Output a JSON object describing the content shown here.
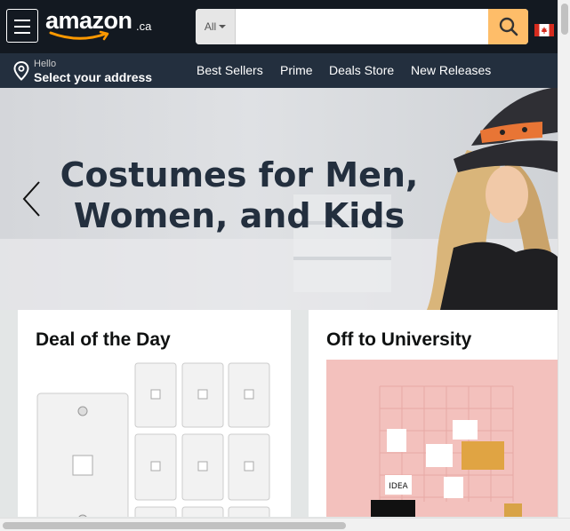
{
  "header": {
    "logo_text": "amazon",
    "logo_suffix": ".ca",
    "search": {
      "category": "All",
      "placeholder": "",
      "value": ""
    },
    "icons": {
      "menu": "hamburger-menu-icon",
      "search": "search-icon",
      "flag": "canada-flag-icon"
    },
    "colors": {
      "header_bg": "#131921",
      "nav_bg": "#232f3e",
      "search_button": "#febd69",
      "logo_smile": "#ff9900"
    }
  },
  "nav": {
    "address": {
      "hello": "Hello",
      "label": "Select your address",
      "icon": "location-pin-icon"
    },
    "links": [
      "Best Sellers",
      "Prime",
      "Deals Store",
      "New Releases"
    ]
  },
  "hero": {
    "title_line1": "Costumes for Men,",
    "title_line2": "Women, and Kids",
    "prev_icon": "chevron-left-icon"
  },
  "cards": [
    {
      "title": "Deal of the Day"
    },
    {
      "title": "Off to University"
    }
  ],
  "deal_image_text": {
    "idea_note": "IDEA"
  }
}
